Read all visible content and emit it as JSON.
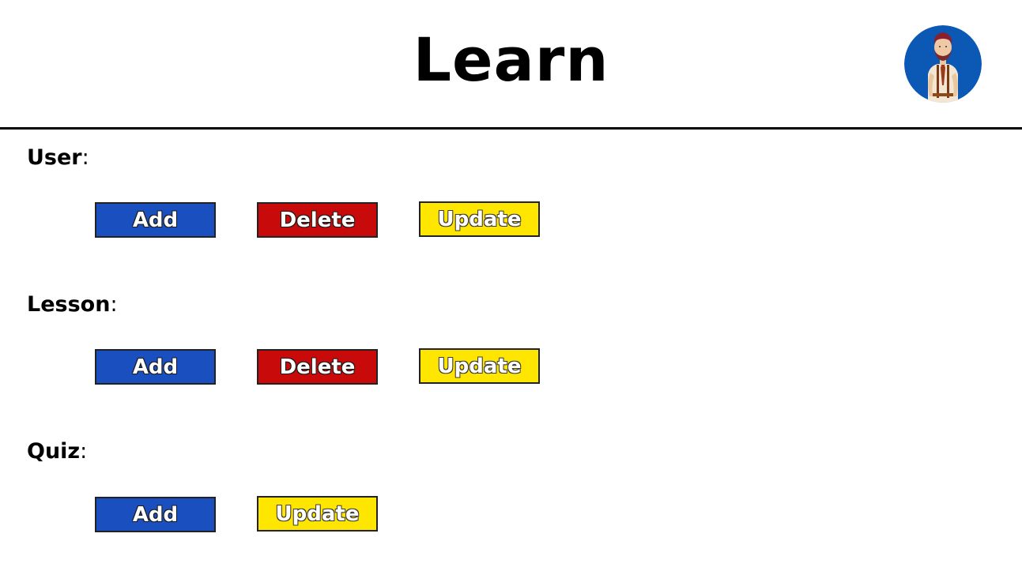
{
  "header": {
    "title": "Learn",
    "avatar_icon": "user-avatar-icon"
  },
  "colors": {
    "add": "#1a4fbf",
    "delete": "#c80a0a",
    "update": "#ffe600"
  },
  "sections": {
    "user": {
      "title": "User",
      "colon": ":",
      "add_label": "Add",
      "delete_label": "Delete",
      "update_label": "Update"
    },
    "lesson": {
      "title": "Lesson",
      "colon": ":",
      "add_label": "Add",
      "delete_label": "Delete",
      "update_label": "Update"
    },
    "quiz": {
      "title": "Quiz",
      "colon": ":",
      "add_label": "Add",
      "update_label": "Update"
    }
  }
}
